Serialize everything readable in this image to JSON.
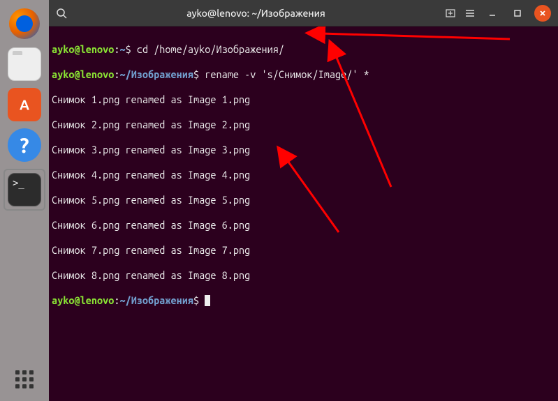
{
  "dock": {
    "items": [
      {
        "name": "firefox"
      },
      {
        "name": "files"
      },
      {
        "name": "software-center"
      },
      {
        "name": "help"
      },
      {
        "name": "terminal"
      }
    ],
    "help_glyph": "?"
  },
  "titlebar": {
    "title": "ayko@lenovo: ~/Изображения"
  },
  "prompt": {
    "user_host": "ayko@lenovo",
    "colon": ":",
    "dollar": "$",
    "home_path": "~",
    "images_path": "~/Изображения"
  },
  "commands": {
    "cd": " cd /home/ayko/Изображения/",
    "rename": " rename -v 's/Снимок/Image/' *"
  },
  "output_lines": [
    "Снимок 1.png renamed as Image 1.png",
    "Снимок 2.png renamed as Image 2.png",
    "Снимок 3.png renamed as Image 3.png",
    "Снимок 4.png renamed as Image 4.png",
    "Снимок 5.png renamed as Image 5.png",
    "Снимок 6.png renamed as Image 6.png",
    "Снимок 7.png renamed as Image 7.png",
    "Снимок 8.png renamed as Image 8.png"
  ],
  "arrows": {
    "color": "#ff0000"
  }
}
